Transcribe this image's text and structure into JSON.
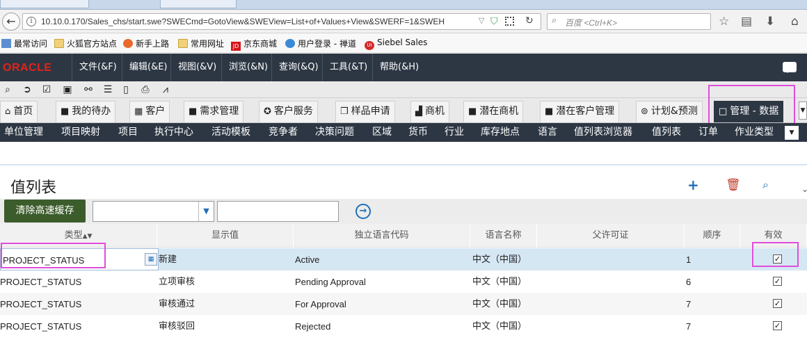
{
  "browser": {
    "url": "10.10.0.170/Sales_chs/start.swe?SWECmd=GotoView&SWEView=List+of+Values+View&SWERF=1&SWEH",
    "search_placeholder": "百度 <Ctrl+K>"
  },
  "bookmarks": [
    {
      "label": "最常访问",
      "icon": "bookmark-icon"
    },
    {
      "label": "火狐官方站点",
      "icon": "folder-icon"
    },
    {
      "label": "新手上路",
      "icon": "firefox-icon"
    },
    {
      "label": "常用网址",
      "icon": "folder-icon"
    },
    {
      "label": "京东商城",
      "icon": "jd-icon"
    },
    {
      "label": "用户登录 - 禅道",
      "icon": "globe-icon"
    },
    {
      "label": "Siebel Sales",
      "icon": "siebel-icon"
    }
  ],
  "menubar": {
    "logo": "ORACLE",
    "items": [
      "文件(&F)",
      "编辑(&E)",
      "视图(&V)",
      "浏览(&N)",
      "查询(&Q)",
      "工具(&T)",
      "帮助(&H)"
    ]
  },
  "tabs": [
    {
      "label": "首页",
      "icon": "home-icon"
    },
    {
      "label": "我的待办",
      "icon": "page-icon"
    },
    {
      "label": "客户",
      "icon": "building-icon"
    },
    {
      "label": "需求管理",
      "icon": "page-icon"
    },
    {
      "label": "客户服务",
      "icon": "compass-icon"
    },
    {
      "label": "样品申请",
      "icon": "cubes-icon"
    },
    {
      "label": "商机",
      "icon": "chart-icon"
    },
    {
      "label": "潜在商机",
      "icon": "page-icon"
    },
    {
      "label": "潜在客户管理",
      "icon": "page-icon"
    },
    {
      "label": "计划&预测",
      "icon": "coin-icon"
    },
    {
      "label": "管理 - 数据",
      "icon": "page-icon",
      "active": true
    }
  ],
  "subnav": [
    "单位管理",
    "项目映射",
    "项目",
    "执行中心",
    "活动模板",
    "竞争者",
    "决策问题",
    "区域",
    "货币",
    "行业",
    "库存地点",
    "语言",
    "值列表浏览器",
    "值列表",
    "订单",
    "作业类型"
  ],
  "list": {
    "title": "值列表",
    "clear_cache": "清除高速缓存",
    "columns": [
      "类型",
      "显示值",
      "独立语言代码",
      "语言名称",
      "父许可证",
      "顺序",
      "有效"
    ],
    "sort_marker": "▲▼",
    "rows": [
      {
        "type": "PROJECT_STATUS",
        "display": "新建",
        "code": "Active",
        "lang": "中文（中国）",
        "parent": "",
        "order": "1",
        "active": true
      },
      {
        "type": "PROJECT_STATUS",
        "display": "立项审核",
        "code": "Pending Approval",
        "lang": "中文（中国）",
        "parent": "",
        "order": "6",
        "active": true
      },
      {
        "type": "PROJECT_STATUS",
        "display": "审核通过",
        "code": "For Approval",
        "lang": "中文（中国）",
        "parent": "",
        "order": "7",
        "active": true
      },
      {
        "type": "PROJECT_STATUS",
        "display": "审核驳回",
        "code": "Rejected",
        "lang": "中文（中国）",
        "parent": "",
        "order": "7",
        "active": true
      }
    ]
  }
}
